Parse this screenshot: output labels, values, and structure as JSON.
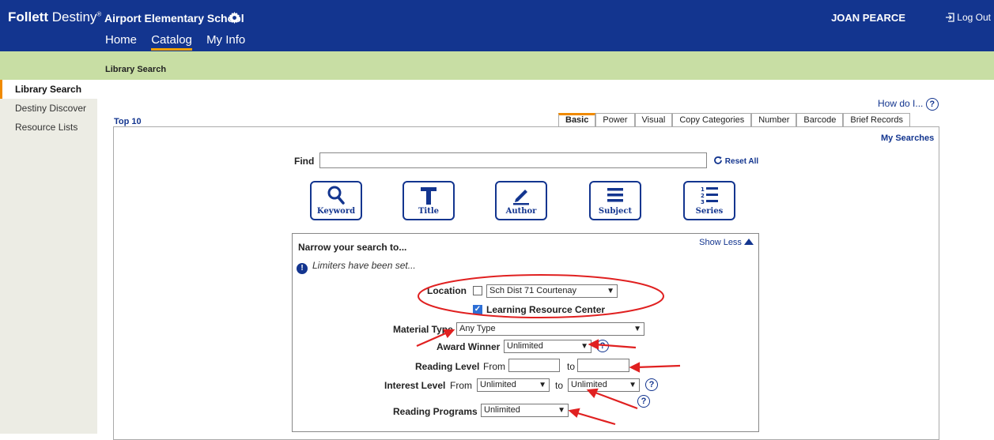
{
  "header": {
    "brand_bold": "Follett",
    "brand_rest": " Destiny",
    "brand_reg": "®",
    "school": "Airport Elementary School",
    "nav": [
      "Home",
      "Catalog",
      "My Info"
    ],
    "user": "JOAN PEARCE",
    "logout": "Log Out"
  },
  "breadcrumb": "Library Search",
  "sidebar": {
    "items": [
      "Library Search",
      "Destiny Discover",
      "Resource Lists"
    ]
  },
  "help": {
    "label": "How do I...",
    "icon": "?"
  },
  "top10": "Top 10",
  "tabs": [
    "Basic",
    "Power",
    "Visual",
    "Copy Categories",
    "Number",
    "Barcode",
    "Brief Records"
  ],
  "my_searches": "My Searches",
  "find": {
    "label": "Find",
    "value": "",
    "reset": "Reset All"
  },
  "search_buttons": [
    {
      "label": "Keyword",
      "icon": "magnifier-icon"
    },
    {
      "label": "Title",
      "icon": "letter-t-icon"
    },
    {
      "label": "Author",
      "icon": "pencil-icon"
    },
    {
      "label": "Subject",
      "icon": "lines-icon"
    },
    {
      "label": "Series",
      "icon": "numbered-list-icon"
    }
  ],
  "narrow": {
    "title": "Narrow your search to...",
    "show_less": "Show Less",
    "limiters_note": "Limiters have been set...",
    "location_label": "Location",
    "location_value": "Sch Dist 71 Courtenay",
    "location_checked": false,
    "lrc_label": "Learning Resource Center",
    "lrc_checked": true,
    "material_type_label": "Material Type",
    "material_type_value": "Any Type",
    "award_winner_label": "Award Winner",
    "award_winner_value": "Unlimited",
    "reading_level_label": "Reading Level",
    "from_label": "From",
    "to_label": "to",
    "reading_level_from": "",
    "reading_level_to": "",
    "interest_level_label": "Interest Level",
    "interest_level_from": "Unlimited",
    "interest_level_to": "Unlimited",
    "reading_programs_label": "Reading Programs",
    "reading_programs_value": "Unlimited",
    "help_icon": "?"
  },
  "colors": {
    "header": "#13358f",
    "breadcrumb_bar": "#c8dea4",
    "accent": "#f08a00",
    "annotation": "#e02020"
  }
}
